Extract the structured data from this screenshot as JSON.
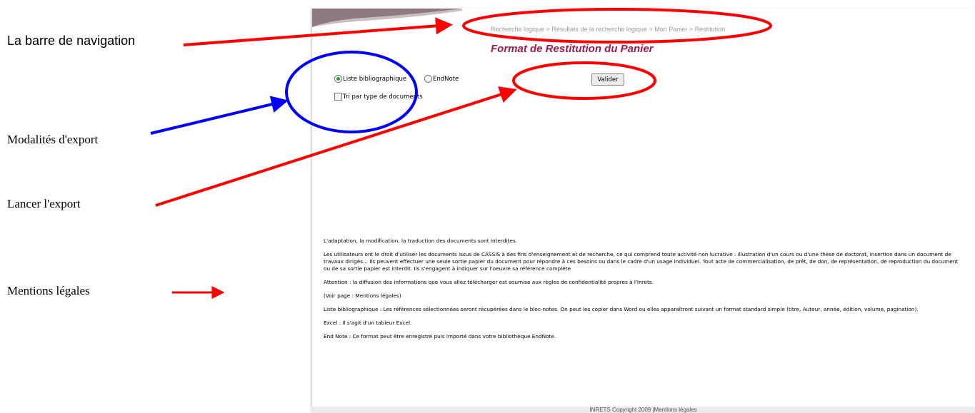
{
  "annotations": {
    "navigation": "La barre de navigation",
    "export_options": "Modalités d'export",
    "launch_export": "Lancer l'export",
    "legal_notices": "Mentions légales"
  },
  "breadcrumb": {
    "items": [
      "Recherche logique",
      "Résultats de la recherche logique",
      "Mon Panier",
      "Restitution"
    ],
    "separator": ">"
  },
  "page_title": "Format de Restitution du Panier",
  "options": {
    "liste_label": "Liste bibliographique",
    "endnote_label": "EndNote",
    "selected": "Liste bibliographique",
    "tri_label": "Tri par type de documents",
    "tri_checked": false
  },
  "valider_label": "Valider",
  "legal": {
    "p1": "L'adaptation, la modification, la traduction des documents sont interdites.",
    "p2": "Les utilisateurs ont le droit d'utiliser les documents issus de CASSIS à des fins d'enseignement et de recherche, ce qui comprend toute activité non lucrative : illustration d'un cours ou d'une thèse de doctorat, insertion dans un document de travaux dirigés... Ils peuvent effectuer une seule sortie papier du document pour répondre à ces besoins ou dans le cadre d'un usage individuel. Tout acte de commercialisation, de prêt, de don, de représentation, de reproduction du document ou de sa sortie papier est interdit. Ils s'engagent à indiquer sur l'oeuvre sa référence complète",
    "p3": "Attention : la diffusion des informations que vous allez télécharger est soumise aux règles de confidentialité propres à l'Inrets.",
    "p4": "(Voir page : Mentions légales)",
    "p5": "Liste bibliographique : Les références sélectionnées seront récupérées dans le bloc-notes. On peut les copier dans Word ou elles apparaîtront suivant un format standard simple (titre, Auteur, année, édition, volume, pagination).",
    "p6": "Excel : Il s'agit d'un tableur Excel.",
    "p7": "End Note : Ce format peut être enregistré puis importé dans votre bibliothèque EndNote."
  },
  "footer": "INRETS Copyright 2009 |Mentions légales",
  "colors": {
    "title": "#9c1b4d",
    "red_annotation": "#ff0000",
    "blue_annotation": "#0000ff"
  }
}
